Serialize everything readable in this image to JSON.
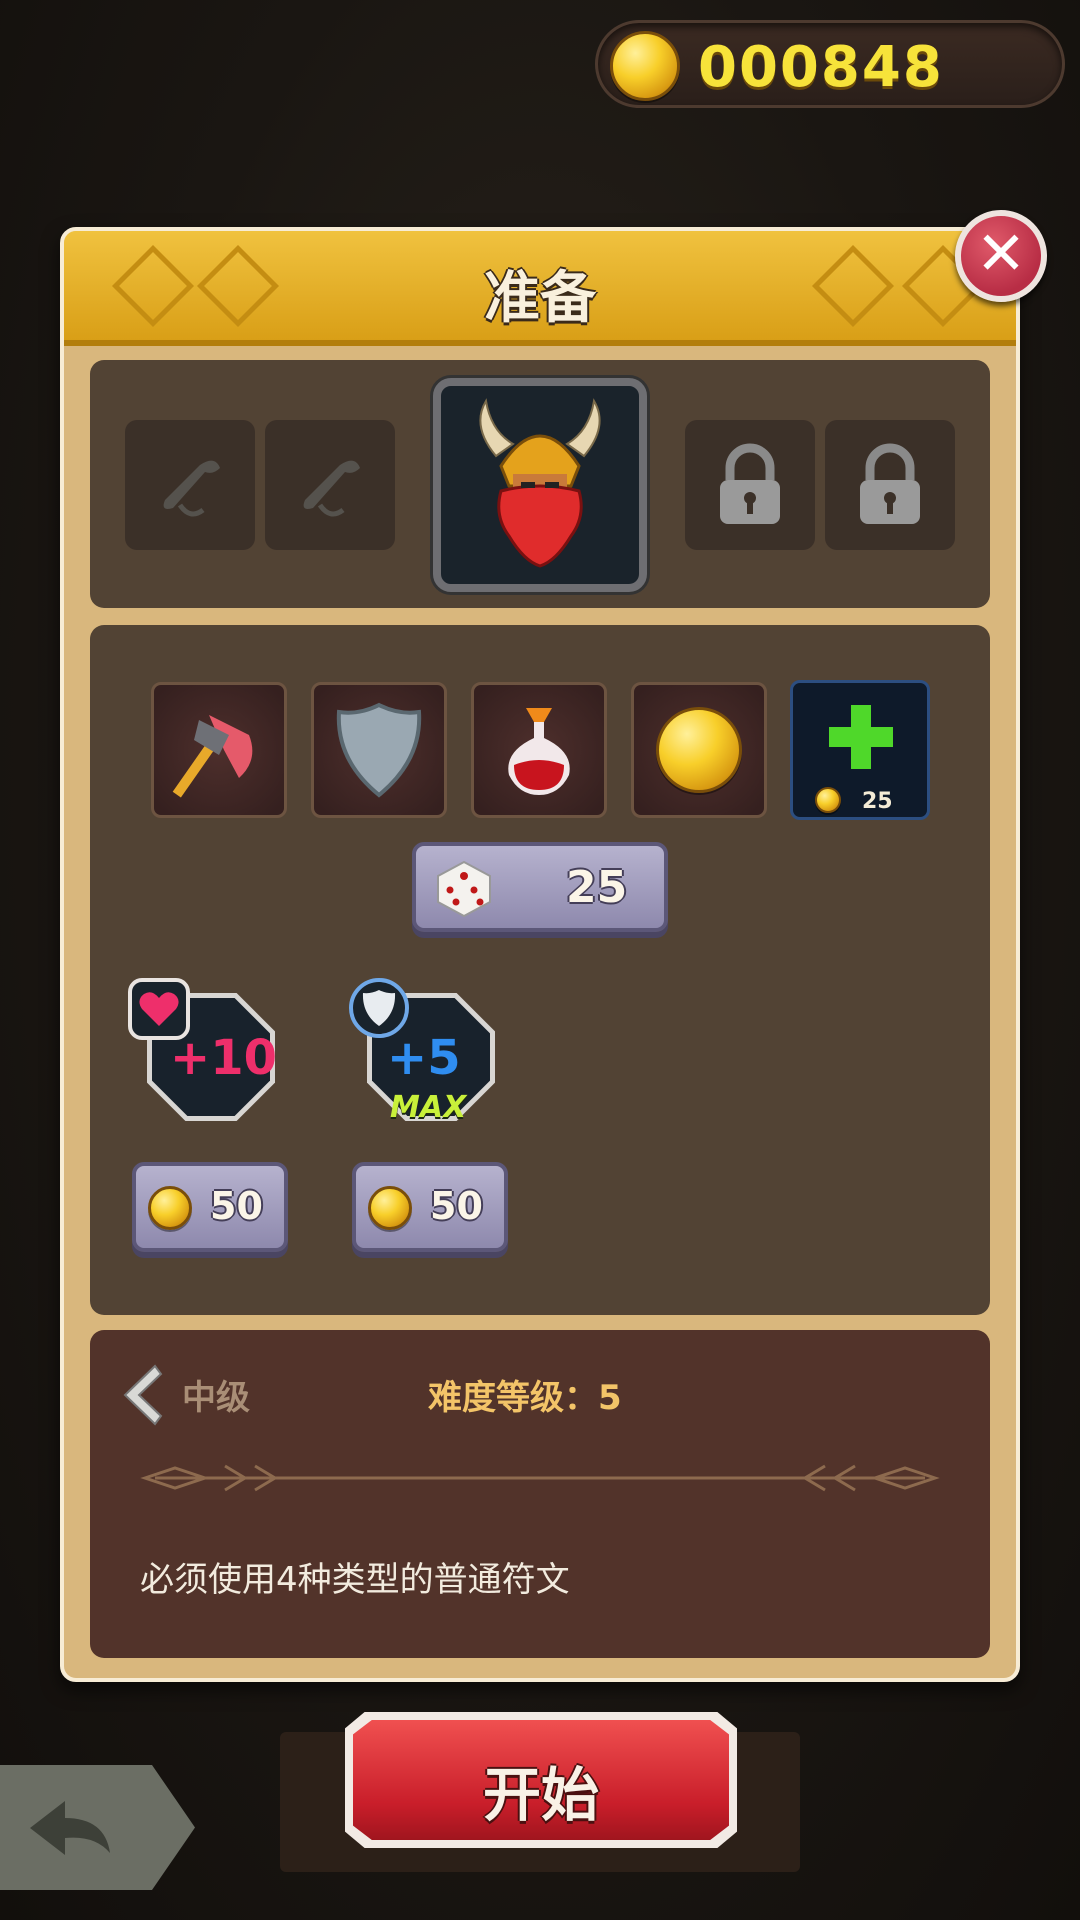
{
  "coins": {
    "value": "000848"
  },
  "panel": {
    "title": "准备",
    "close_icon": "close-icon"
  },
  "hero": {
    "left_slots": [
      "scroll-icon",
      "scroll-icon"
    ],
    "portrait": "viking-dwarf-portrait",
    "right_slots": [
      "lock-icon",
      "lock-icon"
    ]
  },
  "items": {
    "slots": [
      "axe-icon",
      "shield-icon",
      "potion-icon",
      "gold-coin-icon"
    ],
    "add_cost": "25",
    "dice_cost": "25"
  },
  "upgrades": [
    {
      "icon": "heart-icon",
      "value": "+10",
      "max": "",
      "cost": "50",
      "color": "#ee2f6b"
    },
    {
      "icon": "shield-icon",
      "value": "+5",
      "max": "MAX",
      "cost": "50",
      "color": "#2f8df0"
    }
  ],
  "info": {
    "level": "中级",
    "difficulty": "难度等级：5",
    "description": "必须使用4种类型的普通符文"
  },
  "start_button": {
    "label": "开始"
  }
}
